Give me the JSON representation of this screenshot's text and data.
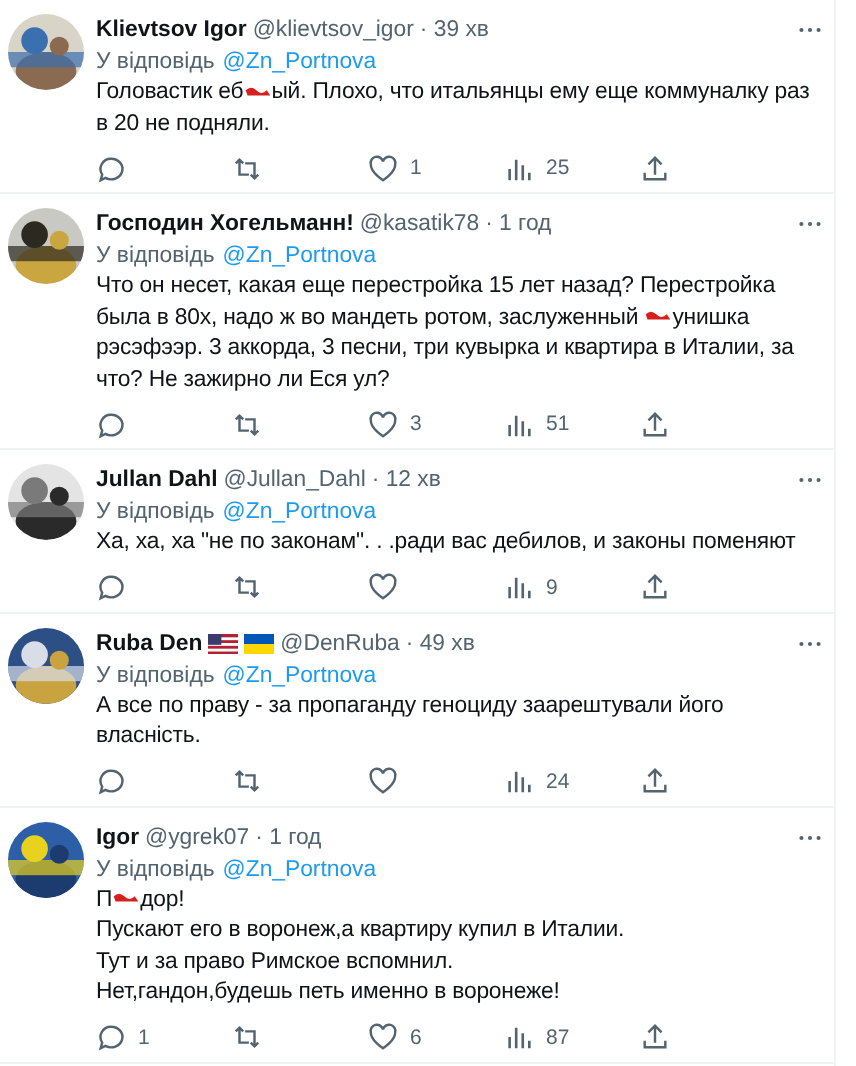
{
  "tweets": [
    {
      "author": {
        "name": "Klievtsov Igor",
        "handle": "@klievtsov_igor"
      },
      "time": "· 39 хв",
      "reply_label": "У відповідь",
      "reply_to": "@Zn_Portnova",
      "paragraphs": [
        [
          {
            "kind": "text",
            "text": "Головастик еб"
          },
          {
            "kind": "censor"
          },
          {
            "kind": "text",
            "text": "ый. Плохо, что итальянцы ему еще коммуналку раз в 20 не подняли."
          }
        ]
      ],
      "stats": {
        "likes": "1",
        "views": "25"
      }
    },
    {
      "author": {
        "name": "Господин Хогельманн!",
        "handle": "@kasatik78"
      },
      "time": "· 1 год",
      "reply_label": "У відповідь",
      "reply_to": "@Zn_Portnova",
      "paragraphs": [
        [
          {
            "kind": "text",
            "text": "Что он несет, какая еще перестройка 15 лет назад? Перестройка была в 80х, надо ж во мандеть ротом,  заслуженный "
          },
          {
            "kind": "censor"
          },
          {
            "kind": "text",
            "text": "унишка рэсэфээр. 3 аккорда, 3 песни, три кувырка и квартира в Италии, за что? Не зажирно ли Еся ул?"
          }
        ]
      ],
      "stats": {
        "likes": "3",
        "views": "51"
      }
    },
    {
      "author": {
        "name": "Jullan Dahl",
        "handle": "@Jullan_Dahl"
      },
      "time": "· 12 хв",
      "reply_label": "У відповідь",
      "reply_to": "@Zn_Portnova",
      "paragraphs": [
        [
          {
            "kind": "text",
            "text": "Ха, ха, ха \"не по законам\". . .ради вас дебилов,  и законы поменяют"
          }
        ]
      ],
      "stats": {
        "views": "9"
      }
    },
    {
      "author": {
        "name": "Ruba Den",
        "handle": "@DenRuba",
        "flags": [
          {
            "kind": "us"
          },
          {
            "kind": "ua"
          }
        ]
      },
      "time": "· 49 хв",
      "reply_label": "У відповідь",
      "reply_to": "@Zn_Portnova",
      "paragraphs": [
        [
          {
            "kind": "text",
            "text": "А все по праву - за пропаганду геноциду заарештували його власність."
          }
        ]
      ],
      "stats": {
        "views": "24"
      }
    },
    {
      "author": {
        "name": "Igor",
        "handle": "@ygrek07"
      },
      "time": "· 1 год",
      "reply_label": "У відповідь",
      "reply_to": "@Zn_Portnova",
      "paragraphs": [
        [
          {
            "kind": "text",
            "text": "П"
          },
          {
            "kind": "censor"
          },
          {
            "kind": "text",
            "text": "дор!"
          }
        ],
        [
          {
            "kind": "text",
            "text": "Пускают его в воронеж,а квартиру купил в Италии."
          }
        ],
        [
          {
            "kind": "text",
            "text": "Тут и за право Римское вспомнил."
          }
        ],
        [
          {
            "kind": "text",
            "text": "Нет,гандон,будешь петь именно в воронеже!"
          }
        ]
      ],
      "stats": {
        "replies": "1",
        "likes": "6",
        "views": "87"
      }
    }
  ]
}
